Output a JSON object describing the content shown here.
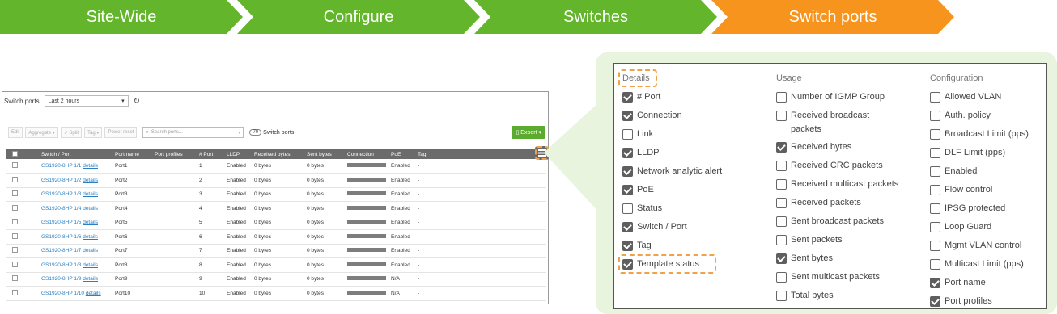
{
  "breadcrumb": [
    "Site-Wide",
    "Configure",
    "Switches",
    "Switch ports"
  ],
  "switch_ports": {
    "title": "Switch ports",
    "time_range": "Last 2 hours",
    "toolbar": [
      "Edit",
      "Aggregate ▾",
      "↗ Split",
      "Tag ▾",
      "Power reset"
    ],
    "search_placeholder": "Search ports...",
    "count": "70",
    "count_label": "Switch ports",
    "export_label": "Export ▾",
    "columns": [
      "Switch / Port",
      "Port name",
      "Port profiles",
      "# Port",
      "LLDP",
      "Received bytes",
      "Sent bytes",
      "Connection",
      "PoE",
      "Tag"
    ],
    "details_label": "details",
    "rows": [
      {
        "switch": "GS1920-8HP 1/1",
        "name": "Port1",
        "port": "1",
        "lldp": "Enabled",
        "rx": "0 bytes",
        "tx": "0 bytes",
        "poe": "Enabled",
        "tag": "-"
      },
      {
        "switch": "GS1920-8HP 1/2",
        "name": "Port2",
        "port": "2",
        "lldp": "Enabled",
        "rx": "0 bytes",
        "tx": "0 bytes",
        "poe": "Enabled",
        "tag": "-"
      },
      {
        "switch": "GS1920-8HP 1/3",
        "name": "Port3",
        "port": "3",
        "lldp": "Enabled",
        "rx": "0 bytes",
        "tx": "0 bytes",
        "poe": "Enabled",
        "tag": "-"
      },
      {
        "switch": "GS1920-8HP 1/4",
        "name": "Port4",
        "port": "4",
        "lldp": "Enabled",
        "rx": "0 bytes",
        "tx": "0 bytes",
        "poe": "Enabled",
        "tag": "-"
      },
      {
        "switch": "GS1920-8HP 1/5",
        "name": "Port5",
        "port": "5",
        "lldp": "Enabled",
        "rx": "0 bytes",
        "tx": "0 bytes",
        "poe": "Enabled",
        "tag": "-"
      },
      {
        "switch": "GS1920-8HP 1/6",
        "name": "Port6",
        "port": "6",
        "lldp": "Enabled",
        "rx": "0 bytes",
        "tx": "0 bytes",
        "poe": "Enabled",
        "tag": "-"
      },
      {
        "switch": "GS1920-8HP 1/7",
        "name": "Port7",
        "port": "7",
        "lldp": "Enabled",
        "rx": "0 bytes",
        "tx": "0 bytes",
        "poe": "Enabled",
        "tag": "-"
      },
      {
        "switch": "GS1920-8HP 1/8",
        "name": "Port8",
        "port": "8",
        "lldp": "Enabled",
        "rx": "0 bytes",
        "tx": "0 bytes",
        "poe": "Enabled",
        "tag": "-"
      },
      {
        "switch": "GS1920-8HP 1/9",
        "name": "Port9",
        "port": "9",
        "lldp": "Enabled",
        "rx": "0 bytes",
        "tx": "0 bytes",
        "poe": "N/A",
        "tag": "-"
      },
      {
        "switch": "GS1920-8HP 1/10",
        "name": "Port10",
        "port": "10",
        "lldp": "Enabled",
        "rx": "0 bytes",
        "tx": "0 bytes",
        "poe": "N/A",
        "tag": "-"
      }
    ]
  },
  "column_chooser": {
    "details": {
      "heading": "Details",
      "items": [
        {
          "label": "# Port",
          "checked": true
        },
        {
          "label": "Connection",
          "checked": true
        },
        {
          "label": "Link",
          "checked": false
        },
        {
          "label": "LLDP",
          "checked": true
        },
        {
          "label": "Network analytic alert",
          "checked": true
        },
        {
          "label": "PoE",
          "checked": true
        },
        {
          "label": "Status",
          "checked": false
        },
        {
          "label": "Switch / Port",
          "checked": true
        },
        {
          "label": "Tag",
          "checked": true
        },
        {
          "label": "Template status",
          "checked": true
        }
      ]
    },
    "usage": {
      "heading": "Usage",
      "items": [
        {
          "label": "Number of IGMP Group",
          "checked": false
        },
        {
          "label": "Received broadcast packets",
          "checked": false
        },
        {
          "label": "Received bytes",
          "checked": true
        },
        {
          "label": "Received CRC packets",
          "checked": false
        },
        {
          "label": "Received multicast packets",
          "checked": false
        },
        {
          "label": "Received packets",
          "checked": false
        },
        {
          "label": "Sent broadcast packets",
          "checked": false
        },
        {
          "label": "Sent packets",
          "checked": false
        },
        {
          "label": "Sent bytes",
          "checked": true
        },
        {
          "label": "Sent multicast packets",
          "checked": false
        },
        {
          "label": "Total bytes",
          "checked": false
        }
      ]
    },
    "configuration": {
      "heading": "Configuration",
      "items": [
        {
          "label": "Allowed VLAN",
          "checked": false
        },
        {
          "label": "Auth. policy",
          "checked": false
        },
        {
          "label": "Broadcast Limit (pps)",
          "checked": false
        },
        {
          "label": "DLF Limit (pps)",
          "checked": false
        },
        {
          "label": "Enabled",
          "checked": false
        },
        {
          "label": "Flow control",
          "checked": false
        },
        {
          "label": "IPSG protected",
          "checked": false
        },
        {
          "label": "Loop Guard",
          "checked": false
        },
        {
          "label": "Mgmt VLAN control",
          "checked": false
        },
        {
          "label": "Multicast Limit (pps)",
          "checked": false
        },
        {
          "label": "Port name",
          "checked": true
        },
        {
          "label": "Port profiles",
          "checked": true
        }
      ]
    }
  },
  "colors": {
    "green": "#63b52b",
    "orange": "#f7941d",
    "callout_bg": "#e8f4dd",
    "highlight": "#f0a24a",
    "link": "#2a7fc4"
  }
}
